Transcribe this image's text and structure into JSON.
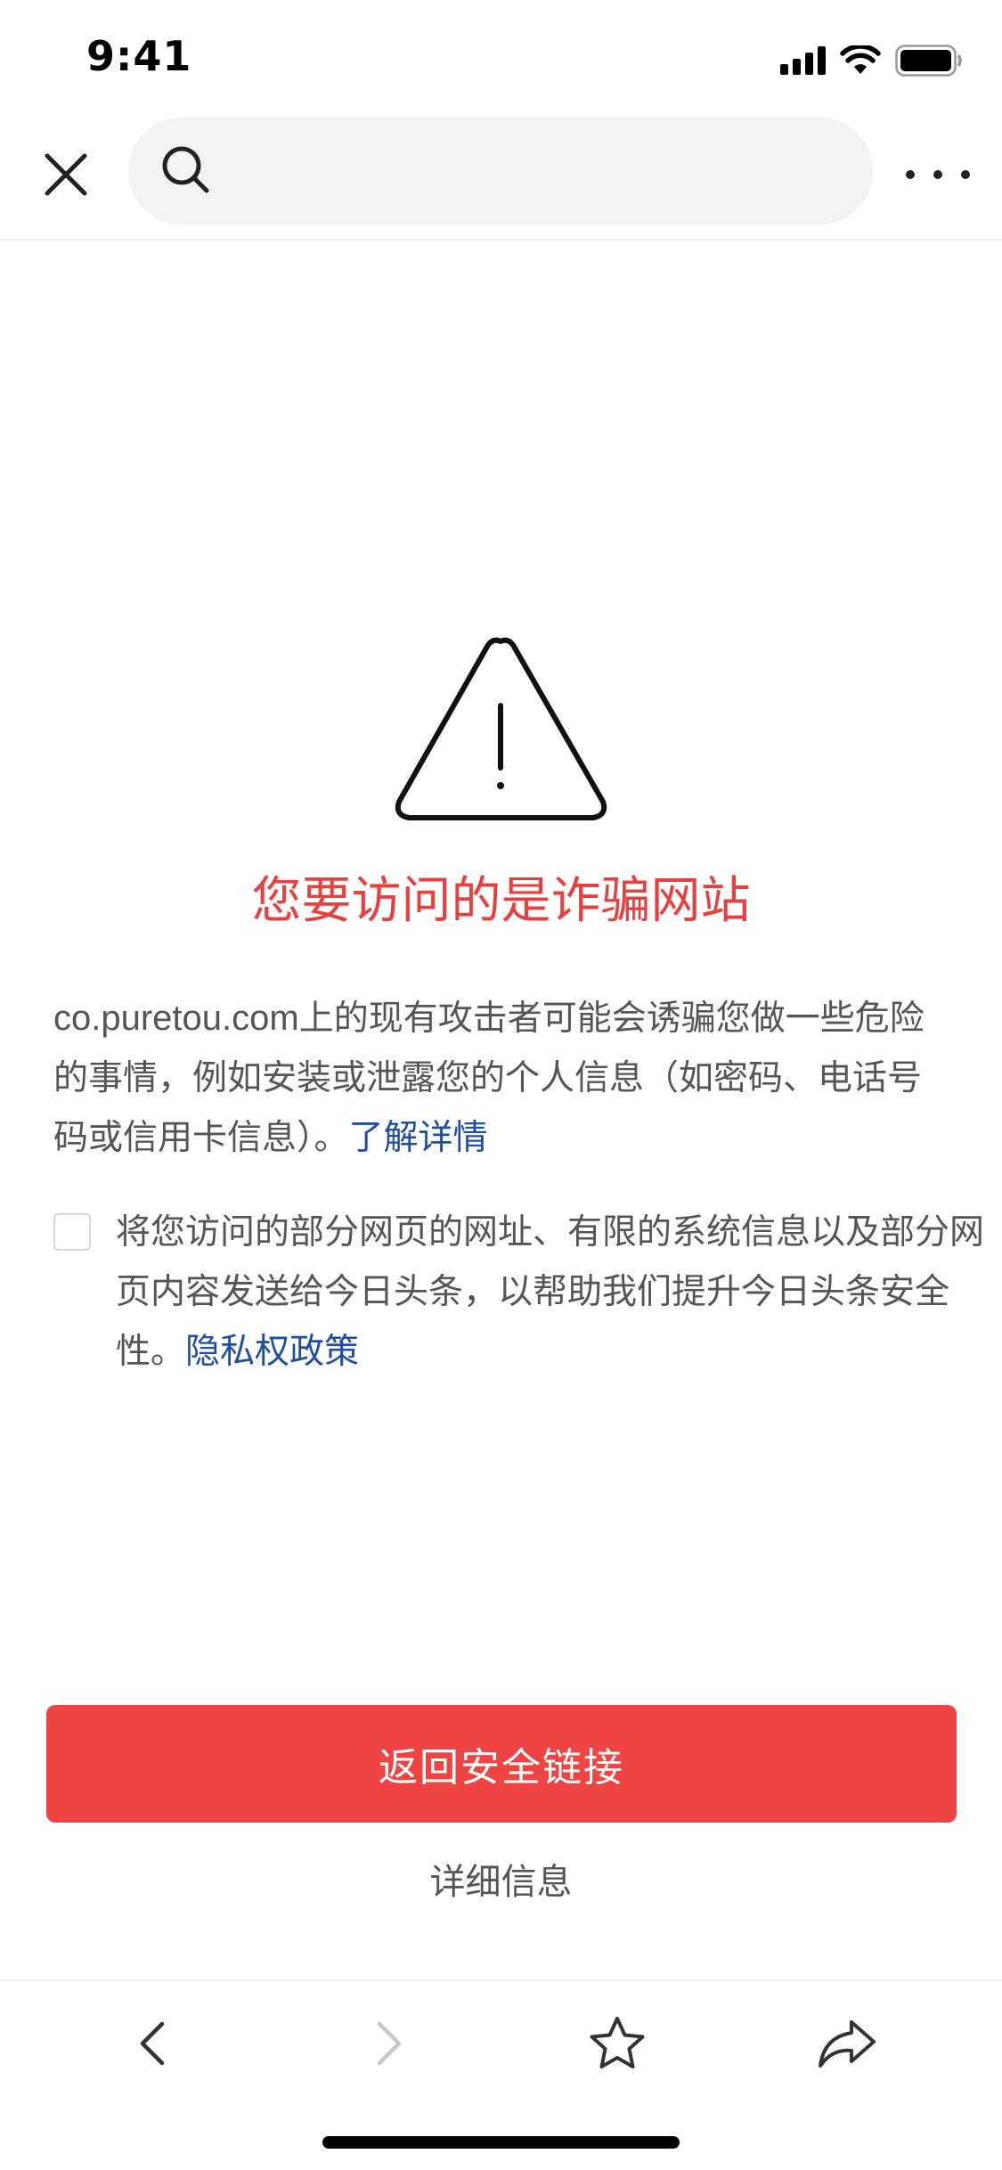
{
  "status_bar": {
    "time": "9:41"
  },
  "nav": {
    "search_placeholder": ""
  },
  "warning": {
    "title": "您要访问的是诈骗网站",
    "description_domain": "co.puretou.com",
    "description_text": "上的现有攻击者可能会诱骗您做一些危险的事情，例如安装或泄露您的个人信息（如密码、电话号码或信用卡信息）。",
    "learn_more": "了解详情"
  },
  "consent": {
    "checked": false,
    "text": "将您访问的部分网页的网址、有限的系统信息以及部分网页内容发送给今日头条，以帮助我们提升今日头条安全性。",
    "privacy_link": "隐私权政策"
  },
  "actions": {
    "back_to_safety": "返回安全链接",
    "details": "详细信息"
  },
  "colors": {
    "accent_red": "#ef4444",
    "title_red": "#e8403f",
    "link_blue": "#1f4f9e"
  },
  "icons": {
    "close": "close-icon",
    "search": "search-icon",
    "more": "more-dots-icon",
    "warning": "warning-triangle-icon",
    "back": "chevron-left-icon",
    "forward": "chevron-right-icon",
    "favorite": "star-icon",
    "share": "share-icon"
  }
}
